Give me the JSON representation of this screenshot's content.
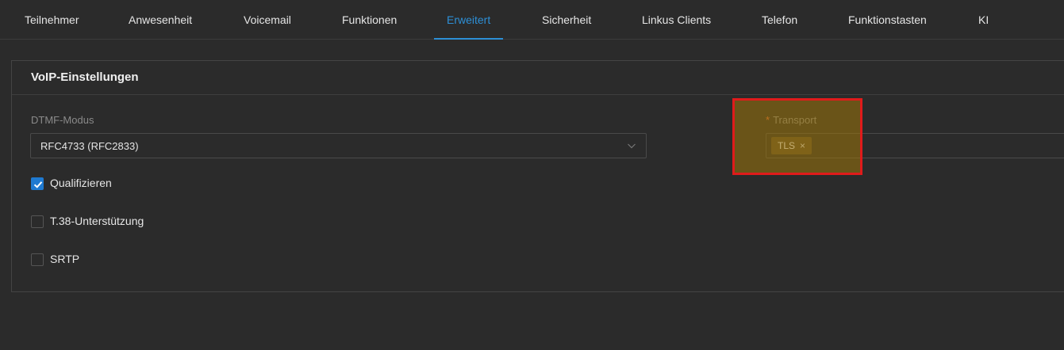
{
  "tabs": [
    {
      "label": "Teilnehmer"
    },
    {
      "label": "Anwesenheit"
    },
    {
      "label": "Voicemail"
    },
    {
      "label": "Funktionen"
    },
    {
      "label": "Erweitert"
    },
    {
      "label": "Sicherheit"
    },
    {
      "label": "Linkus Clients"
    },
    {
      "label": "Telefon"
    },
    {
      "label": "Funktionstasten"
    },
    {
      "label": "KI"
    }
  ],
  "active_tab": "Erweitert",
  "card": {
    "title": "VoIP-Einstellungen"
  },
  "dtmf": {
    "label": "DTMF-Modus",
    "value": "RFC4733 (RFC2833)",
    "icon": "chevron-down-icon"
  },
  "options": [
    {
      "label": "Qualifizieren",
      "checked": true
    },
    {
      "label": "T.38-Unterstützung",
      "checked": false
    },
    {
      "label": "SRTP",
      "checked": false
    }
  ],
  "transport": {
    "required_mark": "*",
    "label": "Transport",
    "tags": [
      {
        "label": "TLS",
        "close": "×"
      }
    ]
  },
  "colors": {
    "accent": "#2d8fd6",
    "checkbox_checked": "#1f7ad1",
    "highlight_border": "#e01b1b",
    "highlight_fill": "#9e760a"
  }
}
